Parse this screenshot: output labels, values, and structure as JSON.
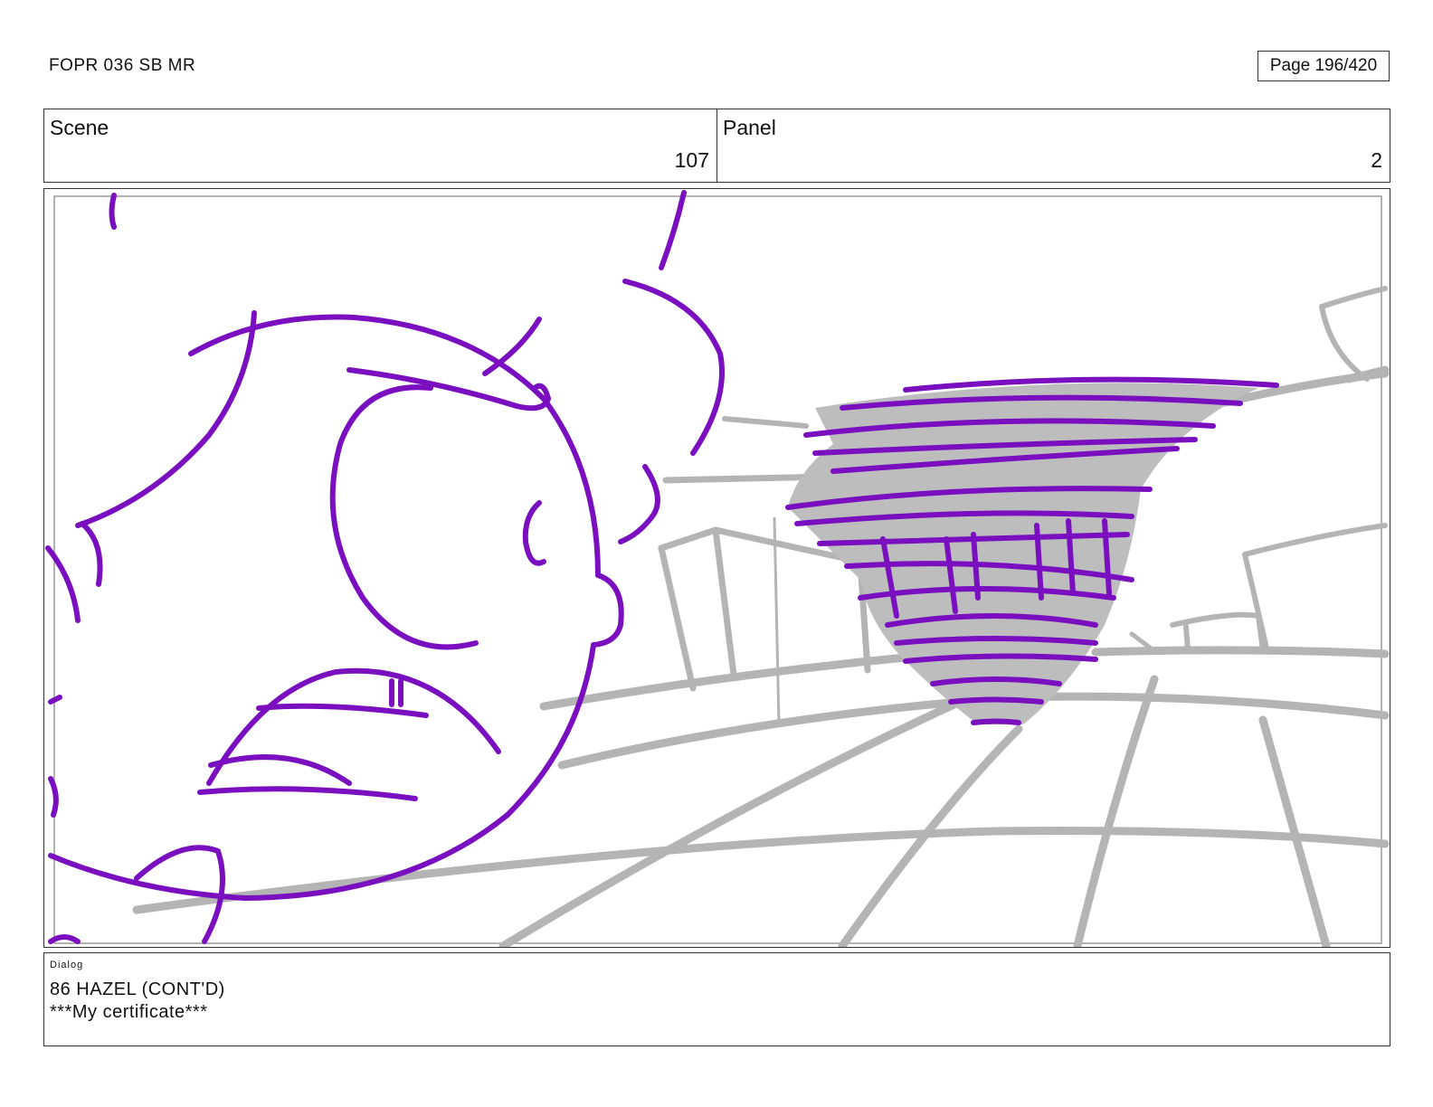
{
  "header": {
    "doc_title": "FOPR 036 SB MR",
    "page_label": "Page 196/420"
  },
  "scene": {
    "label": "Scene",
    "value": "107"
  },
  "panel": {
    "label": "Panel",
    "value": "2"
  },
  "dialog": {
    "label": "Dialog",
    "lines": [
      "86 HAZEL (CONT'D)",
      "***My certificate***"
    ]
  },
  "colors": {
    "line_art": "#7a0fc0",
    "background_lines": "#b4b4b4",
    "tornado_fill": "#bdbdbd"
  }
}
